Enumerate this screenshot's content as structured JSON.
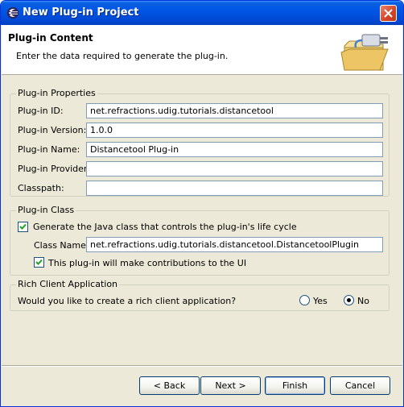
{
  "window": {
    "title": "New Plug-in Project"
  },
  "header": {
    "title": "Plug-in Content",
    "description": "Enter the data required to generate the plug-in."
  },
  "properties": {
    "legend": "Plug-in Properties",
    "id_label": "Plug-in ID:",
    "id_value": "net.refractions.udig.tutorials.distancetool",
    "version_label": "Plug-in Version:",
    "version_value": "1.0.0",
    "name_label": "Plug-in Name:",
    "name_value": "Distancetool Plug-in",
    "provider_label": "Plug-in Provider:",
    "provider_value": "",
    "classpath_label": "Classpath:",
    "classpath_value": ""
  },
  "plugin_class": {
    "legend": "Plug-in Class",
    "generate_label": "Generate the Java class that controls the plug-in's life cycle",
    "generate_checked": true,
    "class_name_label": "Class Name:",
    "class_name_value": "net.refractions.udig.tutorials.distancetool.DistancetoolPlugin",
    "ui_label": "This plug-in will make contributions to the UI",
    "ui_checked": true
  },
  "rich_client": {
    "legend": "Rich Client Application",
    "question": "Would you like to create a rich client application?",
    "yes_label": "Yes",
    "no_label": "No",
    "selected": "No"
  },
  "buttons": {
    "back": "< Back",
    "next": "Next >",
    "finish": "Finish",
    "cancel": "Cancel"
  },
  "icons": {
    "title_icon": "eclipse-icon",
    "header_graphic": "folder-plug-icon",
    "close": "close-icon"
  },
  "colors": {
    "titlebar": "#0055e5",
    "dialog_bg": "#ece9d8",
    "field_border": "#7f9db9",
    "close_button": "#d54325"
  }
}
